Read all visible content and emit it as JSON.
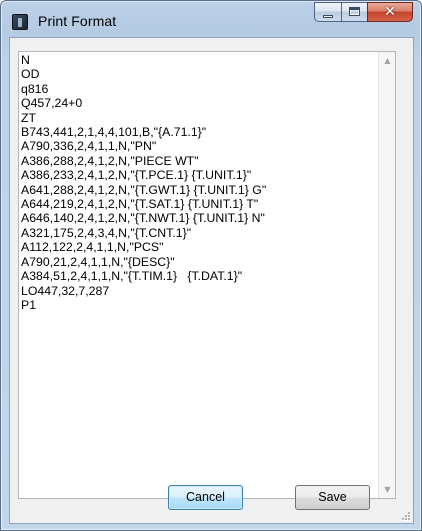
{
  "window": {
    "title": "Print Format"
  },
  "caption_buttons": {
    "minimize": "minimize",
    "maximize": "maximize",
    "close": "close"
  },
  "textbox": {
    "lines": [
      "N",
      "OD",
      "q816",
      "Q457,24+0",
      "ZT",
      "B743,441,2,1,4,4,101,B,\"{A.71.1}\"",
      "A790,336,2,4,1,1,N,\"PN\"",
      "A386,288,2,4,1,2,N,\"PIECE WT\"",
      "A386,233,2,4,1,2,N,\"{T.PCE.1} {T.UNIT.1}\"",
      "A641,288,2,4,1,2,N,\"{T.GWT.1} {T.UNIT.1} G\"",
      "A644,219,2,4,1,2,N,\"{T.SAT.1} {T.UNIT.1} T\"",
      "A646,140,2,4,1,2,N,\"{T.NWT.1} {T.UNIT.1} N\"",
      "A321,175,2,4,3,4,N,\"{T.CNT.1}\"",
      "A112,122,2,4,1,1,N,\"PCS\"",
      "A790,21,2,4,1,1,N,\"{DESC}\"",
      "A384,51,2,4,1,1,N,\"{T.TIM.1}   {T.DAT.1}\"",
      "LO447,32,7,287",
      "P1"
    ]
  },
  "buttons": {
    "cancel": "Cancel",
    "save": "Save"
  }
}
